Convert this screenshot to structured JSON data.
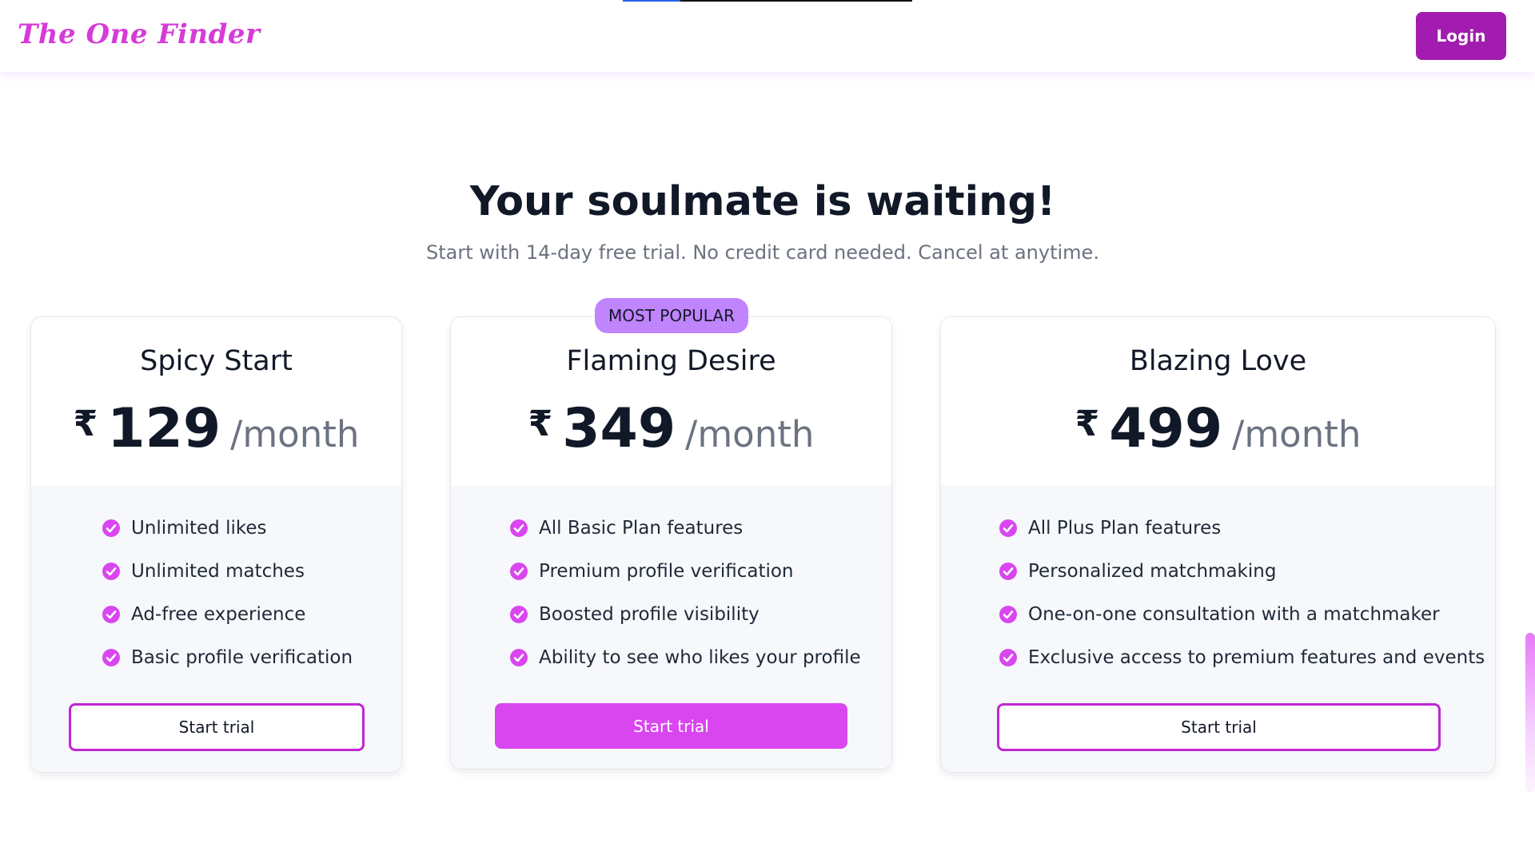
{
  "header": {
    "logo": "The One Finder",
    "login_label": "Login",
    "progress": 0.2
  },
  "hero": {
    "title": "Your soulmate is waiting!",
    "subtitle": "Start with 14-day free trial. No credit card needed. Cancel at anytime."
  },
  "plans": [
    {
      "name": "Spicy Start",
      "currency": "₹",
      "price": "129",
      "period": "/month",
      "features": [
        "Unlimited likes",
        "Unlimited matches",
        "Ad-free experience",
        "Basic profile verification"
      ],
      "cta": "Start trial"
    },
    {
      "name": "Flaming Desire",
      "badge": "MOST POPULAR",
      "currency": "₹",
      "price": "349",
      "period": "/month",
      "features": [
        "All Basic Plan features",
        "Premium profile verification",
        "Boosted profile visibility",
        "Ability to see who likes your profile"
      ],
      "cta": "Start trial"
    },
    {
      "name": "Blazing Love",
      "currency": "₹",
      "price": "499",
      "period": "/month",
      "features": [
        "All Plus Plan features",
        "Personalized matchmaking",
        "One-on-one consultation with a matchmaker",
        "Exclusive access to premium features and events"
      ],
      "cta": "Start trial"
    }
  ],
  "colors": {
    "brand": "#d63bd9",
    "login_bg": "#a21caf",
    "primary_cta": "#d946ef",
    "badge_bg": "#c084fc",
    "check": "#d946ef"
  },
  "icons": {
    "feature_bullet": "check-circle-icon"
  }
}
